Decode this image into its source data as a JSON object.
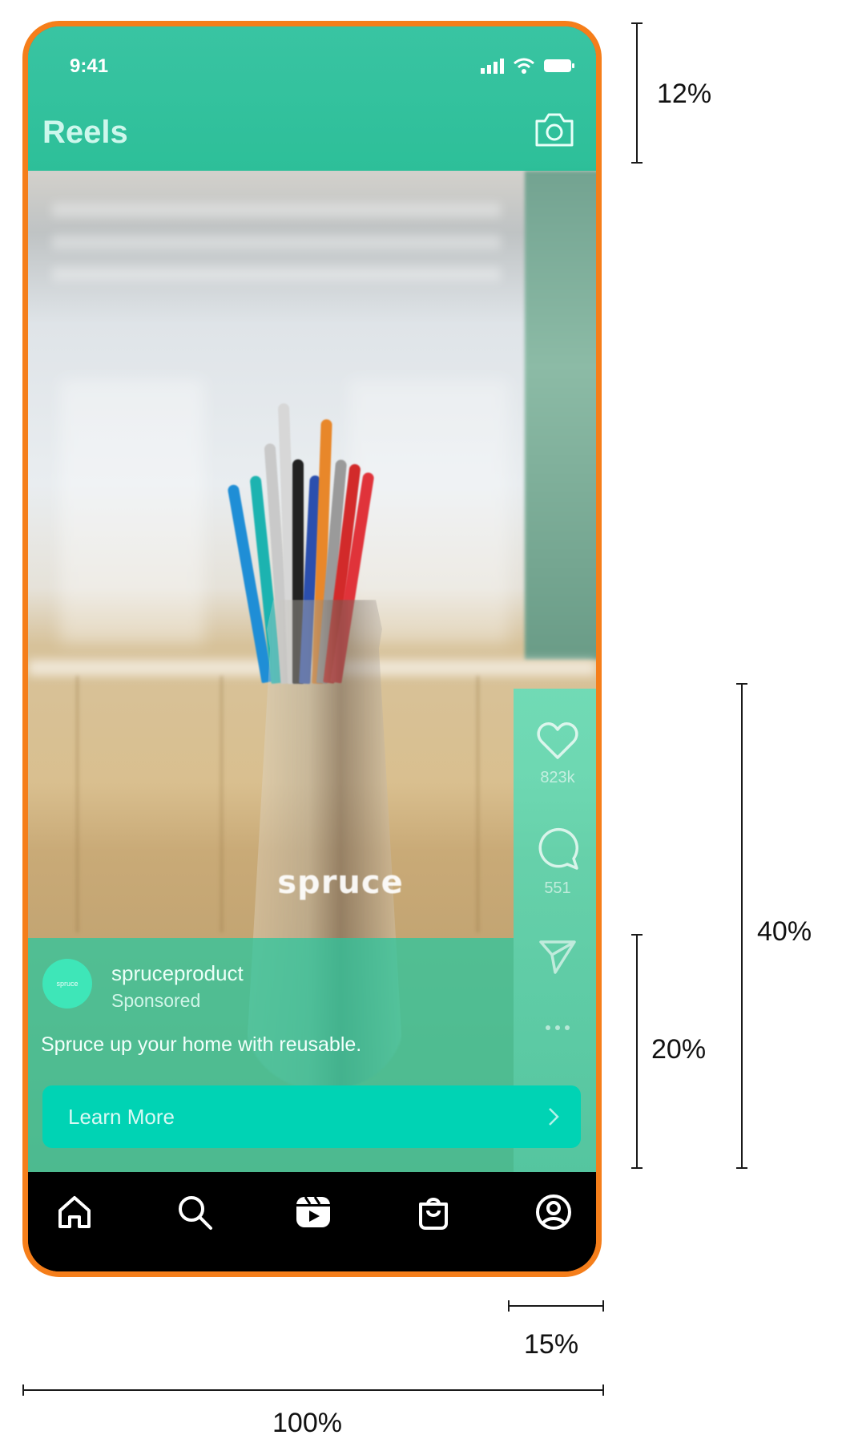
{
  "status_bar": {
    "time": "9:41"
  },
  "header": {
    "title": "Reels"
  },
  "post": {
    "username": "spruceproduct",
    "sponsored_label": "Sponsored",
    "caption": "Spruce up your home with reusable.",
    "avatar_text": "spruce",
    "image_brand_text": "spruce",
    "cta_label": "Learn More"
  },
  "actions": {
    "likes": "823k",
    "comments": "551"
  },
  "tabs": [
    "home",
    "search",
    "reels",
    "shop",
    "profile"
  ],
  "annotations": {
    "header_height": "12%",
    "action_rail_height": "40%",
    "info_panel_height": "20%",
    "rail_width": "15%",
    "phone_width": "100%"
  },
  "colors": {
    "frame": "#F57E1A",
    "accent": "#00D3B4",
    "header": "#2DC4A0"
  }
}
